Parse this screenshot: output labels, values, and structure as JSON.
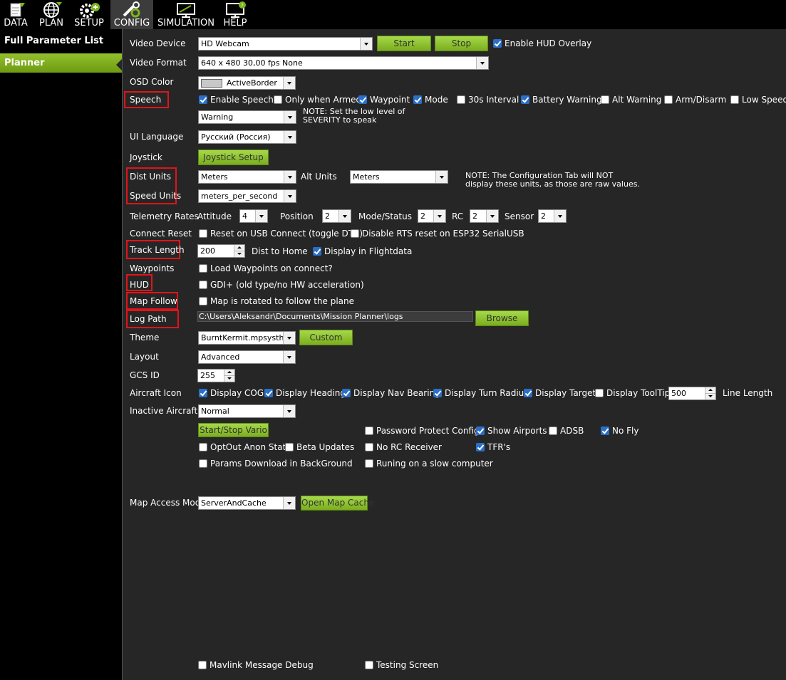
{
  "topnav": {
    "items": [
      {
        "label": "DATA",
        "icon": "data-icon"
      },
      {
        "label": "PLAN",
        "icon": "globe-icon"
      },
      {
        "label": "SETUP",
        "icon": "gear-plus-icon"
      },
      {
        "label": "CONFIG",
        "icon": "wrench-icon",
        "active": true
      },
      {
        "label": "SIMULATION",
        "icon": "monitor-icon"
      },
      {
        "label": "HELP",
        "icon": "help-monitor-icon"
      }
    ]
  },
  "sidebar": {
    "items": [
      {
        "label": "Full Parameter List"
      },
      {
        "label": "Planner",
        "selected": true
      }
    ]
  },
  "colors": {
    "accent": "#8dbb26",
    "highlight": "#e0141b",
    "check": "#2a6fc9"
  },
  "form": {
    "video_device": {
      "label": "Video Device",
      "value": "HD Webcam",
      "start": "Start",
      "stop": "Stop",
      "hud_overlay": "Enable HUD Overlay"
    },
    "video_format": {
      "label": "Video Format",
      "value": "640 x 480 30,00 fps None"
    },
    "osd_color": {
      "label": "OSD Color",
      "value": "ActiveBorder"
    },
    "speech": {
      "label": "Speech",
      "options": [
        {
          "label": "Enable Speech",
          "checked": true
        },
        {
          "label": "Only when Armed",
          "checked": false
        },
        {
          "label": "Waypoint",
          "checked": true
        },
        {
          "label": "Mode",
          "checked": true
        },
        {
          "label": "30s Interval",
          "checked": false
        },
        {
          "label": "Battery Warning",
          "checked": true
        },
        {
          "label": "Alt Warning",
          "checked": false
        },
        {
          "label": "Arm/Disarm",
          "checked": false
        },
        {
          "label": "Low Speed",
          "checked": false
        }
      ],
      "severity": "Warning",
      "note": "NOTE: Set the low level of SEVERITY to speak"
    },
    "ui_language": {
      "label": "UI Language",
      "value": "Русский (Россия)"
    },
    "joystick": {
      "label": "Joystick",
      "button": "Joystick Setup"
    },
    "dist_units": {
      "label": "Dist Units",
      "value": "Meters",
      "alt_label": "Alt Units",
      "alt_value": "Meters",
      "note": "NOTE: The Configuration Tab will NOT display these units, as those are raw values."
    },
    "speed_units": {
      "label": "Speed Units",
      "value": "meters_per_second"
    },
    "telemetry": {
      "label": "Telemetry Rates",
      "attitude_label": "Attitude",
      "attitude": "4",
      "position_label": "Position",
      "position": "2",
      "mode_label": "Mode/Status",
      "mode": "2",
      "rc_label": "RC",
      "rc": "2",
      "sensor_label": "Sensor",
      "sensor": "2"
    },
    "connect_reset": {
      "label": "Connect Reset",
      "opt1": "Reset on USB Connect (toggle DTR)",
      "opt2": "Disable RTS reset on ESP32 SerialUSB"
    },
    "track_length": {
      "label": "Track Length",
      "value": "200",
      "dist_home": "Dist to Home",
      "display_flight": "Display in Flightdata"
    },
    "waypoints": {
      "label": "Waypoints",
      "opt": "Load Waypoints on connect?"
    },
    "hud": {
      "label": "HUD",
      "opt": "GDI+ (old type/no HW acceleration)"
    },
    "map_follow": {
      "label": "Map Follow",
      "opt": "Map is rotated to follow the plane"
    },
    "log_path": {
      "label": "Log Path",
      "value": "C:\\Users\\Aleksandr\\Documents\\Mission Planner\\logs",
      "browse": "Browse"
    },
    "theme": {
      "label": "Theme",
      "value": "BurntKermit.mpsystheme",
      "custom": "Custom"
    },
    "layout": {
      "label": "Layout",
      "value": "Advanced"
    },
    "gcs_id": {
      "label": "GCS ID",
      "value": "255"
    },
    "aircraft_icon": {
      "label": "Aircraft Icon",
      "options": [
        {
          "label": "Display COG",
          "checked": true
        },
        {
          "label": "Display Heading",
          "checked": true
        },
        {
          "label": "Display Nav Bearing",
          "checked": true
        },
        {
          "label": "Display Turn Radius",
          "checked": true
        },
        {
          "label": "Display Target",
          "checked": true
        },
        {
          "label": "Display ToolTip",
          "checked": false
        }
      ],
      "line_value": "500",
      "line_label": "Line Length"
    },
    "inactive_aircraft": {
      "label": "Inactive Aircraft",
      "value": "Normal"
    },
    "misc": {
      "vario": "Start/Stop Vario",
      "password": "Password Protect Config",
      "show_airports": "Show Airports",
      "adsb": "ADSB",
      "no_fly": "No Fly",
      "optout": "OptOut Anon Stats",
      "beta": "Beta Updates",
      "no_rc": "No RC Receiver",
      "tfr": "TFR's",
      "params_bg": "Params Download in BackGround",
      "slow": "Runing on a slow computer"
    },
    "map_access": {
      "label": "Map Access Mode",
      "value": "ServerAndCache",
      "open_cache": "Open Map Cache"
    },
    "bottom": {
      "mavlink": "Mavlink Message Debug",
      "testing": "Testing Screen"
    }
  }
}
